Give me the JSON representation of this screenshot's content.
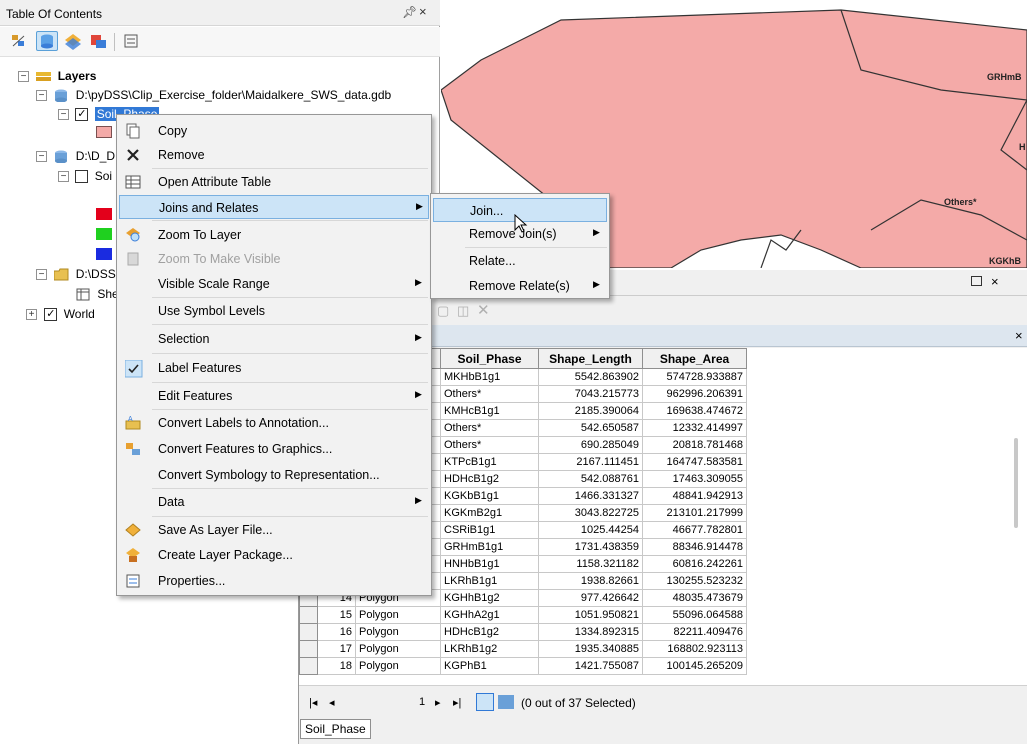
{
  "toc": {
    "title": "Table Of Contents",
    "pin": "❀",
    "close": "×",
    "layers_label": "Layers",
    "db_path": "D:\\pyDSS\\Clip_Exercise_folder\\Maidalkere_SWS_data.gdb",
    "soil_phase": "Soil_Phase",
    "db2_path": "D:\\D_D",
    "soil2": "Soi",
    "db3_path": "D:\\DSS",
    "sheet": "She",
    "world": "World"
  },
  "map": {
    "labels": [
      "GRHmB",
      "Others*",
      "KGKhB",
      "H"
    ]
  },
  "context_menu": {
    "items": [
      {
        "label": "Copy",
        "icon": "copy-icon"
      },
      {
        "label": "Remove",
        "icon": "remove-icon"
      },
      {
        "label": "Open Attribute Table",
        "icon": "table-icon"
      },
      {
        "label": "Joins and Relates",
        "icon": "",
        "submenu": true
      },
      {
        "label": "Zoom To Layer",
        "icon": "zoom-layer-icon"
      },
      {
        "label": "Zoom To Make Visible",
        "icon": "zoom-visible-icon",
        "disabled": true
      },
      {
        "label": "Visible Scale Range",
        "icon": "",
        "submenu": true
      },
      {
        "label": "Use Symbol Levels",
        "icon": ""
      },
      {
        "label": "Selection",
        "icon": "",
        "submenu": true
      },
      {
        "label": "Label Features",
        "icon": "check-icon"
      },
      {
        "label": "Edit Features",
        "icon": "",
        "submenu": true
      },
      {
        "label": "Convert Labels to Annotation...",
        "icon": "annotation-icon"
      },
      {
        "label": "Convert Features to Graphics...",
        "icon": "graphics-icon"
      },
      {
        "label": "Convert Symbology to Representation...",
        "icon": ""
      },
      {
        "label": "Data",
        "icon": "",
        "submenu": true
      },
      {
        "label": "Save As Layer File...",
        "icon": "layer-file-icon"
      },
      {
        "label": "Create Layer Package...",
        "icon": "layer-package-icon"
      },
      {
        "label": "Properties...",
        "icon": "properties-icon"
      }
    ]
  },
  "submenu": {
    "items": [
      {
        "label": "Join...",
        "submenu": false
      },
      {
        "label": "Remove Join(s)",
        "submenu": true
      },
      {
        "label": "Relate...",
        "submenu": false
      },
      {
        "label": "Remove Relate(s)",
        "submenu": true
      }
    ]
  },
  "table": {
    "columns": [
      "Soil_Phase",
      "Shape_Length",
      "Shape_Area"
    ],
    "rows": [
      {
        "id": "",
        "shape": "",
        "soil": "MKHbB1g1",
        "len": "5542.863902",
        "area": "574728.933887"
      },
      {
        "id": "",
        "shape": "",
        "soil": "Others*",
        "len": "7043.215773",
        "area": "962996.206391"
      },
      {
        "id": "",
        "shape": "",
        "soil": "KMHcB1g1",
        "len": "2185.390064",
        "area": "169638.474672"
      },
      {
        "id": "",
        "shape": "",
        "soil": "Others*",
        "len": "542.650587",
        "area": "12332.414997"
      },
      {
        "id": "",
        "shape": "",
        "soil": "Others*",
        "len": "690.285049",
        "area": "20818.781468"
      },
      {
        "id": "",
        "shape": "",
        "soil": "KTPcB1g1",
        "len": "2167.111451",
        "area": "164747.583581"
      },
      {
        "id": "",
        "shape": "",
        "soil": "HDHcB1g2",
        "len": "542.088761",
        "area": "17463.309055"
      },
      {
        "id": "",
        "shape": "",
        "soil": "KGKbB1g1",
        "len": "1466.331327",
        "area": "48841.942913"
      },
      {
        "id": "",
        "shape": "",
        "soil": "KGKmB2g1",
        "len": "3043.822725",
        "area": "213101.217999"
      },
      {
        "id": "",
        "shape": "",
        "soil": "CSRiB1g1",
        "len": "1025.44254",
        "area": "46677.782801"
      },
      {
        "id": "",
        "shape": "",
        "soil": "GRHmB1g1",
        "len": "1731.438359",
        "area": "88346.914478"
      },
      {
        "id": "",
        "shape": "",
        "soil": "HNHbB1g1",
        "len": "1158.321182",
        "area": "60816.242261"
      },
      {
        "id": "",
        "shape": "",
        "soil": "LKRhB1g1",
        "len": "1938.82661",
        "area": "130255.523232"
      },
      {
        "id": "14",
        "shape": "Polygon",
        "soil": "KGHhB1g2",
        "len": "977.426642",
        "area": "48035.473679"
      },
      {
        "id": "15",
        "shape": "Polygon",
        "soil": "KGHhA2g1",
        "len": "1051.950821",
        "area": "55096.064588"
      },
      {
        "id": "16",
        "shape": "Polygon",
        "soil": "HDHcB1g2",
        "len": "1334.892315",
        "area": "82211.409476"
      },
      {
        "id": "17",
        "shape": "Polygon",
        "soil": "LKRhB1g2",
        "len": "1935.340885",
        "area": "168802.923113"
      },
      {
        "id": "18",
        "shape": "Polygon",
        "soil": "KGPhB1",
        "len": "1421.755087",
        "area": "100145.265209"
      }
    ],
    "nav_record": "1",
    "status": "(0 out of 37 Selected)",
    "tab_label": "Soil_Phase"
  },
  "colors": {
    "map_fill": "#f4aaa8",
    "highlight": "#cce4f7",
    "legend_red": "#e3001b",
    "legend_green": "#1fd01f",
    "legend_blue": "#1a2be0"
  }
}
